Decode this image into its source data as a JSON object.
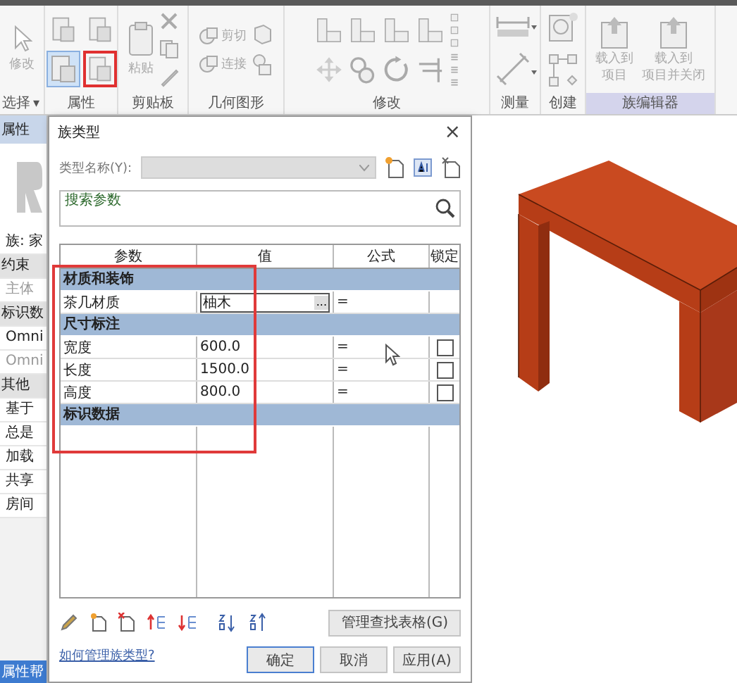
{
  "ribbon": {
    "panels": [
      {
        "kind": "select",
        "label": "选择",
        "caret": "▾",
        "tools": [
          {
            "label": "修改"
          }
        ]
      },
      {
        "kind": "properties",
        "label": "属性",
        "buttons": [
          {
            "selected": false,
            "framed": false
          },
          {
            "selected": false,
            "framed": false
          },
          {
            "selected": true,
            "framed": false
          },
          {
            "selected": false,
            "framed": true
          }
        ]
      },
      {
        "kind": "clipboard",
        "label": "剪贴板",
        "tools": [
          {
            "label": "粘贴"
          }
        ]
      },
      {
        "kind": "geometry",
        "label": "几何图形",
        "tools": [
          {
            "label": "剪切"
          },
          {
            "label": "连接"
          }
        ]
      },
      {
        "kind": "modify",
        "label": "修改"
      },
      {
        "kind": "measure",
        "label": "测量"
      },
      {
        "kind": "create",
        "label": "创建"
      },
      {
        "kind": "family_editor",
        "label": "族编辑器",
        "highlighted": true,
        "tools": [
          {
            "lines": [
              "载入到",
              "项目"
            ]
          },
          {
            "lines": [
              "载入到",
              "项目并关闭"
            ]
          }
        ]
      }
    ]
  },
  "properties_panel": {
    "title": "属性",
    "rows": [
      {
        "kind": "item",
        "text": "族: 家"
      },
      {
        "kind": "group",
        "text": "约束"
      },
      {
        "kind": "item",
        "text": "主体",
        "disabled": true
      },
      {
        "kind": "group",
        "text": "标识数"
      },
      {
        "kind": "item",
        "text": "Omni"
      },
      {
        "kind": "item",
        "text": "Omni",
        "disabled": true
      },
      {
        "kind": "group",
        "text": "其他"
      },
      {
        "kind": "item",
        "text": "基于"
      },
      {
        "kind": "item",
        "text": "总是"
      },
      {
        "kind": "item",
        "text": "加载"
      },
      {
        "kind": "item",
        "text": "共享"
      },
      {
        "kind": "item",
        "text": "房间"
      }
    ],
    "help_link": "属性帮"
  },
  "dialog": {
    "title": "族类型",
    "close": "×",
    "type_name_label": "类型名称(Y):",
    "search": {
      "placeholder": "搜索参数"
    },
    "table": {
      "columns": [
        "参数",
        "值",
        "公式",
        "锁定"
      ],
      "framed": true,
      "rows": [
        {
          "kind": "group",
          "label": "材质和装饰"
        },
        {
          "kind": "param",
          "name": "茶几材质",
          "value": "柚木",
          "browse": "...",
          "formula": "=",
          "active": true
        },
        {
          "kind": "group",
          "label": "尺寸标注"
        },
        {
          "kind": "param",
          "name": "宽度",
          "value": "600.0",
          "formula": "=",
          "locked": false
        },
        {
          "kind": "param",
          "name": "长度",
          "value": "1500.0",
          "formula": "=",
          "locked": false
        },
        {
          "kind": "param",
          "name": "高度",
          "value": "800.0",
          "formula": "=",
          "locked": false
        },
        {
          "kind": "group",
          "label": "标识数据"
        }
      ]
    },
    "lookup_button": "管理查找表格(G)",
    "help_link": "如何管理族类型?",
    "buttons": [
      {
        "label": "确定",
        "default": true
      },
      {
        "label": "取消",
        "default": false
      },
      {
        "label": "应用(A)",
        "default": false
      }
    ]
  }
}
